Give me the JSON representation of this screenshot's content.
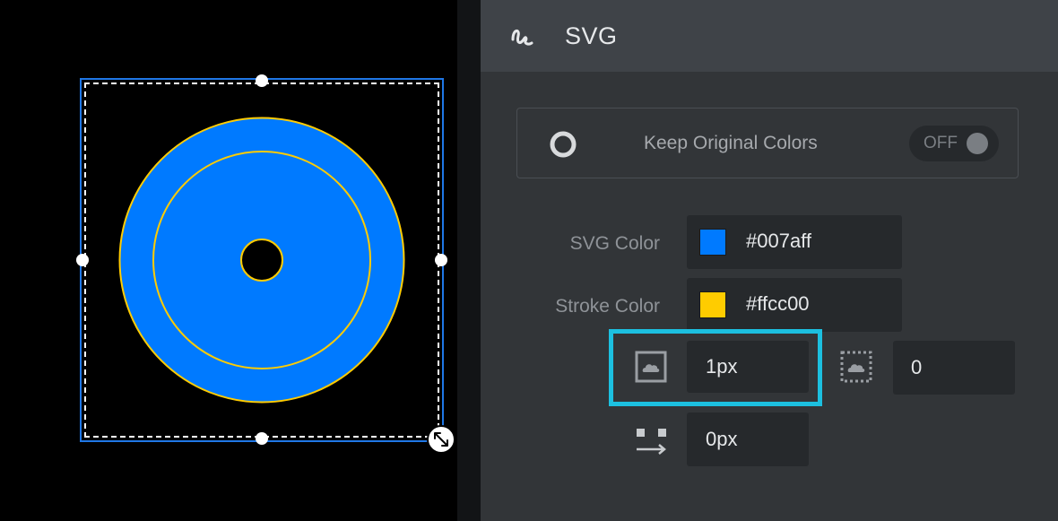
{
  "panel": {
    "title": "SVG",
    "header_icon": "svg-squiggle-icon"
  },
  "keep_original_colors": {
    "label": "Keep Original Colors",
    "toggle_text": "OFF",
    "icon": "ring-icon",
    "enabled": false
  },
  "svg_color": {
    "label": "SVG Color",
    "value": "#007aff",
    "swatch": "#007aff"
  },
  "stroke_color": {
    "label": "Stroke Color",
    "value": "#ffcc00",
    "swatch": "#ffcc00"
  },
  "stroke_width": {
    "icon": "stroke-width-icon",
    "value": "1px"
  },
  "stroke_dash": {
    "icon": "stroke-dash-icon",
    "value": "0"
  },
  "offset": {
    "icon": "offset-icon",
    "value": "0px"
  },
  "colors": {
    "fill": "#007aff",
    "stroke": "#ffcc00",
    "selection": "#1f77e6",
    "highlight": "#1cc0e0"
  }
}
